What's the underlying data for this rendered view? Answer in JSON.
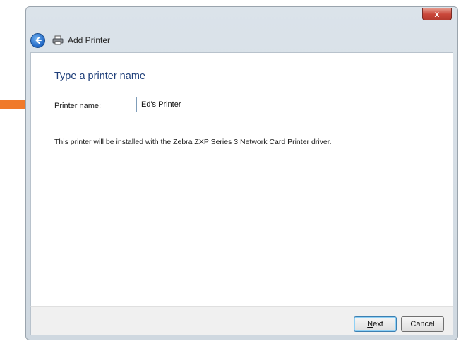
{
  "window": {
    "close_glyph": "x"
  },
  "header": {
    "title": "Add Printer",
    "back_icon": "back-arrow-icon",
    "app_icon": "printer-icon"
  },
  "main": {
    "heading": "Type a printer name",
    "printer_name_label_accel": "P",
    "printer_name_label_rest": "rinter name:",
    "printer_name_value": "Ed's Printer",
    "info_text": "This printer will be installed with the Zebra ZXP Series 3 Network Card Printer driver."
  },
  "buttons": {
    "next_accel": "N",
    "next_rest": "ext",
    "cancel_label": "Cancel"
  },
  "colors": {
    "arrow": "#f07a2a",
    "heading": "#1f3f7a",
    "close": "#c9473a"
  }
}
